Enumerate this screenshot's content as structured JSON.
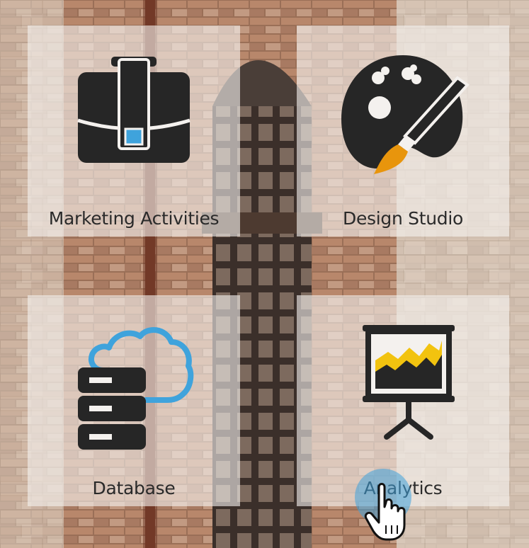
{
  "tiles": [
    {
      "label": "Marketing Activities",
      "icon": "briefcase-icon"
    },
    {
      "label": "Design Studio",
      "icon": "palette-icon"
    },
    {
      "label": "Database",
      "icon": "cloud-database-icon"
    },
    {
      "label": "Analytics",
      "icon": "presentation-chart-icon"
    }
  ],
  "colors": {
    "icon_dark": "#262626",
    "accent_blue": "#3fa3dc",
    "accent_orange": "#e8950c",
    "accent_yellow": "#f2c30f",
    "tile_bg": "rgba(244,241,238,0.62)",
    "label_text": "#2a2a2a"
  }
}
